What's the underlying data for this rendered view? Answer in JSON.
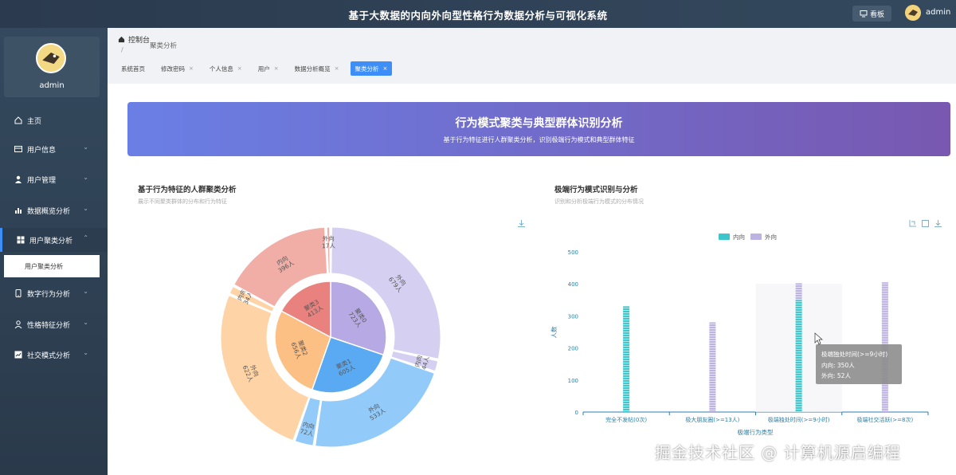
{
  "header": {
    "title": "基于大数据的内向外向型性格行为数据分析与可视化系统",
    "kanban": "看板",
    "user": "admin"
  },
  "sidebar": {
    "username": "admin",
    "items": [
      {
        "label": "主页",
        "icon": "home-icon"
      },
      {
        "label": "用户信息",
        "icon": "card-icon"
      },
      {
        "label": "用户管理",
        "icon": "user-icon"
      },
      {
        "label": "数据概览分析",
        "icon": "bar-chart-icon"
      },
      {
        "label": "用户聚类分析",
        "icon": "grid-icon"
      },
      {
        "label": "数字行为分析",
        "icon": "phone-icon"
      },
      {
        "label": "性格特征分析",
        "icon": "person-icon"
      },
      {
        "label": "社交模式分析",
        "icon": "chart-box-icon"
      }
    ],
    "subitem": "用户聚类分析"
  },
  "breadcrumb": {
    "home": "控制台",
    "sep": "/",
    "current": "聚类分析"
  },
  "tabs": [
    {
      "label": "系统首页",
      "closable": false
    },
    {
      "label": "修改密码",
      "closable": true
    },
    {
      "label": "个人信息",
      "closable": true
    },
    {
      "label": "用户",
      "closable": true
    },
    {
      "label": "数据分析概览",
      "closable": true
    },
    {
      "label": "聚类分析",
      "closable": true,
      "active": true
    }
  ],
  "close_glyph": "×",
  "banner": {
    "title": "行为模式聚类与典型群体识别分析",
    "subtitle": "基于行为特征进行人群聚类分析，识别极端行为模式和典型群体特征"
  },
  "left_panel": {
    "title": "基于行为特征的人群聚类分析",
    "subtitle": "展示不同聚类群体的分布和行为特征"
  },
  "right_panel": {
    "title": "极端行为模式识别与分析",
    "subtitle": "识别和分析极端行为模式的分布情况"
  },
  "watermark": "掘金技术社区 @ 计算机源启编程",
  "colors": {
    "accent": "#3e8ef7",
    "introvert": "#3cc6cc",
    "extrovert": "#bdb3e3"
  },
  "chart_data": [
    {
      "type": "pie",
      "variant": "nested-sunburst",
      "inner": [
        {
          "name": "聚类0",
          "label": "聚类0\n723人",
          "value": 723,
          "color": "#b7a9e3"
        },
        {
          "name": "聚类1",
          "label": "聚类1\n605人",
          "value": 605,
          "color": "#5aaaf3"
        },
        {
          "name": "聚类2",
          "label": "聚类2\n656人",
          "value": 656,
          "color": "#fcbf84"
        },
        {
          "name": "聚类3",
          "label": "聚类3\n413人",
          "value": 413,
          "color": "#e9827e"
        }
      ],
      "outer": [
        {
          "parent": "聚类0",
          "name": "外向",
          "label": "外向\n679人",
          "value": 679,
          "color": "#d5cff1"
        },
        {
          "parent": "聚类0",
          "name": "内向",
          "label": "内向\n44人",
          "value": 44,
          "color": "#d5cff1"
        },
        {
          "parent": "聚类1",
          "name": "外向",
          "label": "外向\n533人",
          "value": 533,
          "color": "#92cafa"
        },
        {
          "parent": "聚类1",
          "name": "内向",
          "label": "内向\n72人",
          "value": 72,
          "color": "#92cafa"
        },
        {
          "parent": "聚类2",
          "name": "外向",
          "label": "外向\n622人",
          "value": 622,
          "color": "#fed4a6"
        },
        {
          "parent": "聚类2",
          "name": "内向",
          "label": "内向\n34人",
          "value": 34,
          "color": "#fed4a6"
        },
        {
          "parent": "聚类3",
          "name": "内向",
          "label": "内向\n396人",
          "value": 396,
          "color": "#f0aea7"
        },
        {
          "parent": "聚类3",
          "name": "外向",
          "label": "外向\n17人",
          "value": 17,
          "color": "#f0aea7"
        }
      ]
    },
    {
      "type": "bar",
      "categories": [
        "完全不发帖(0次)",
        "极大朋友圈(>=13人)",
        "极端独处时间(>=9小时)",
        "极端社交活跃(>=8次)"
      ],
      "series": [
        {
          "name": "内向",
          "values": [
            330,
            0,
            350,
            0
          ],
          "color": "#3cc6cc"
        },
        {
          "name": "外向",
          "values": [
            0,
            280,
            52,
            405
          ],
          "color": "#bdb3e3"
        }
      ],
      "xlabel": "极端行为类型",
      "ylabel": "人数",
      "ylim": [
        0,
        500
      ],
      "yticks": [
        0,
        100,
        200,
        300,
        400,
        500
      ],
      "legend": "top-center",
      "tooltip": {
        "title": "极端独处时间(>=9小时)",
        "line1": "内向: 350人",
        "line2": "外向: 52人"
      }
    }
  ]
}
